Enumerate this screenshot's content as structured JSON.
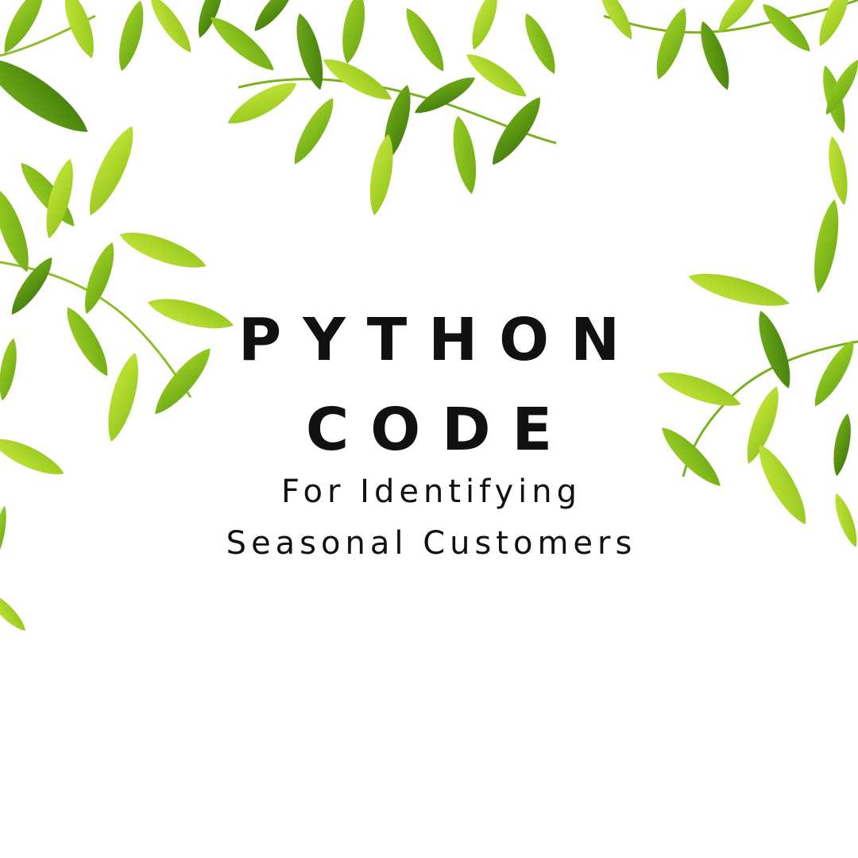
{
  "title": {
    "line1": "PYTHON",
    "line2": "CODE"
  },
  "subtitle": {
    "line1": "For Identifying",
    "line2": "Seasonal Customers"
  },
  "colors": {
    "background": "#ffffff",
    "text": "#111111",
    "leaf_dark": "#5e9a14",
    "leaf_mid": "#8cc21c",
    "leaf_light": "#b2dc2a"
  },
  "decoration": "green-leaves-border"
}
